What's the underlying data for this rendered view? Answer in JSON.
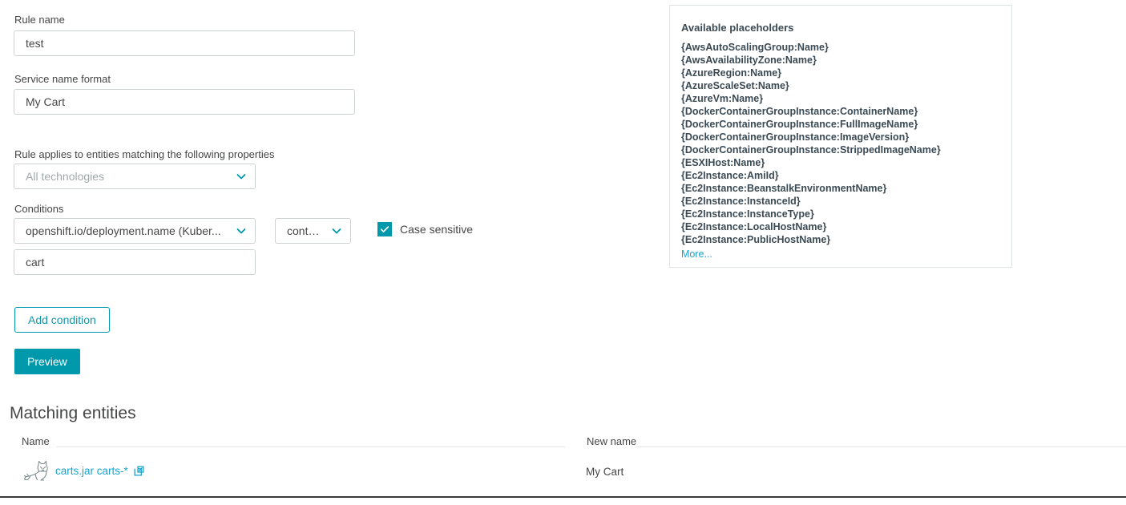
{
  "form": {
    "rule_name_label": "Rule name",
    "rule_name_value": "test",
    "service_name_label": "Service name format",
    "service_name_value": "My Cart",
    "applies_label": "Rule applies to entities matching the following properties",
    "technologies_value": "All technologies",
    "conditions_label": "Conditions",
    "condition_property": "openshift.io/deployment.name (Kuber...",
    "condition_operator": "contains",
    "condition_value": "cart",
    "case_sensitive_label": "Case sensitive",
    "case_sensitive_checked": true,
    "add_condition_label": "Add condition",
    "preview_label": "Preview"
  },
  "placeholders": {
    "title": "Available placeholders",
    "items": [
      "{AwsAutoScalingGroup:Name}",
      "{AwsAvailabilityZone:Name}",
      "{AzureRegion:Name}",
      "{AzureScaleSet:Name}",
      "{AzureVm:Name}",
      "{DockerContainerGroupInstance:ContainerName}",
      "{DockerContainerGroupInstance:FullImageName}",
      "{DockerContainerGroupInstance:ImageVersion}",
      "{DockerContainerGroupInstance:StrippedImageName}",
      "{ESXIHost:Name}",
      "{Ec2Instance:AmiId}",
      "{Ec2Instance:BeanstalkEnvironmentName}",
      "{Ec2Instance:InstanceId}",
      "{Ec2Instance:InstanceType}",
      "{Ec2Instance:LocalHostName}",
      "{Ec2Instance:PublicHostName}"
    ],
    "more_label": "More..."
  },
  "matching": {
    "title": "Matching entities",
    "columns": {
      "name": "Name",
      "new_name": "New name"
    },
    "rows": [
      {
        "icon": "tomcat-cat-icon",
        "name": "carts.jar carts-*",
        "new_name": "My Cart"
      }
    ]
  },
  "colors": {
    "accent_teal": "#0098ab",
    "link_blue": "#1ba3d0",
    "border_gray": "#cdd2d3",
    "text_gray": "#454646"
  }
}
